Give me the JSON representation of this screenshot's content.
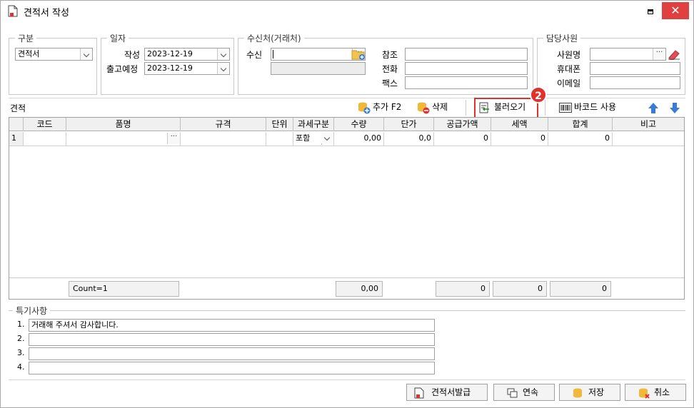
{
  "window": {
    "title": "견적서 작성",
    "close_label": "✕"
  },
  "gubun": {
    "legend": "구분",
    "value": "견적서"
  },
  "ilja": {
    "legend": "일자",
    "write_label": "작성",
    "write_date": "2023-12-19",
    "ship_label": "출고예정",
    "ship_date": "2023-12-19"
  },
  "recipient": {
    "legend": "수신처(거래처)",
    "to_label": "수신",
    "to_value": "",
    "ref_label": "참조",
    "phone_label": "전화",
    "fax_label": "팩스"
  },
  "staff": {
    "legend": "담당사원",
    "emp_label": "사원명",
    "mobile_label": "휴대폰",
    "email_label": "이메일"
  },
  "toolbar": {
    "section_label": "견적",
    "add": "추가 F2",
    "delete": "삭제",
    "import": "불러오기",
    "barcode": "바코드 사용",
    "badge": "2"
  },
  "grid": {
    "headers": [
      "코드",
      "품명",
      "규격",
      "단위",
      "과세구분",
      "수량",
      "단가",
      "공급가액",
      "세액",
      "합계",
      "비고"
    ],
    "row": {
      "num": "1",
      "tax": "포함",
      "qty": "0,00",
      "price": "0,0",
      "supply": "0",
      "tax_amt": "0",
      "total": "0"
    },
    "footer": {
      "count": "Count=1",
      "qty": "0,00",
      "supply": "0",
      "tax": "0",
      "total": "0"
    }
  },
  "notes": {
    "legend": "특기사항",
    "items": [
      {
        "num": "1.",
        "text": "거래해 주셔서 감사합니다."
      },
      {
        "num": "2.",
        "text": ""
      },
      {
        "num": "3.",
        "text": ""
      },
      {
        "num": "4.",
        "text": ""
      }
    ]
  },
  "footer_buttons": {
    "issue": "견적서발급",
    "continue": "연속",
    "save": "저장",
    "cancel": "취소"
  }
}
